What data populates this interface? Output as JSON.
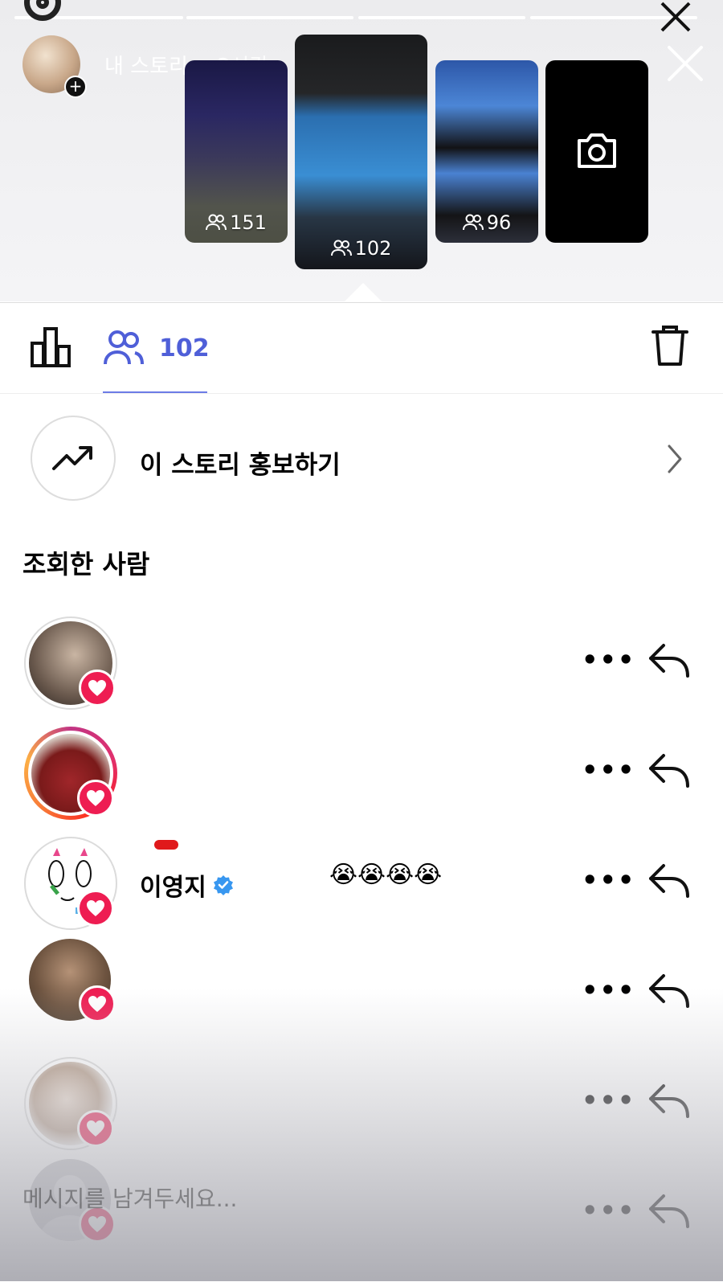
{
  "story_header": {
    "title": "내 스토리",
    "time_ago": "3시간"
  },
  "thumbnails": [
    {
      "count": "151",
      "selected": false
    },
    {
      "count": "102",
      "selected": true
    },
    {
      "count": "96",
      "selected": false
    },
    {
      "type": "camera"
    }
  ],
  "tabs": {
    "insights_icon": "bar-chart-icon",
    "viewers_icon": "people-icon",
    "viewer_count": "102",
    "delete_icon": "trash-icon"
  },
  "promote": {
    "label": "이 스토리 홍보하기",
    "icon": "trend-up-icon"
  },
  "viewers_section": {
    "title": "조회한 사람"
  },
  "viewers": [
    {
      "name": "",
      "liked": true,
      "ring": "gray"
    },
    {
      "name": "",
      "liked": true,
      "ring": "gradient"
    },
    {
      "name": "이영지",
      "verified": true,
      "note": "😭😭😭😭",
      "liked": true,
      "ring": "gray"
    },
    {
      "name": "",
      "liked": true,
      "ring": "none"
    },
    {
      "name": "",
      "liked": true,
      "ring": "gray"
    },
    {
      "name": "",
      "liked": true,
      "ring": "none"
    }
  ],
  "reply_placeholder": "메시지를 남겨두세요...",
  "colors": {
    "accent": "#4f5fd8",
    "heart": "#ee1d52",
    "verified": "#3897f0"
  }
}
